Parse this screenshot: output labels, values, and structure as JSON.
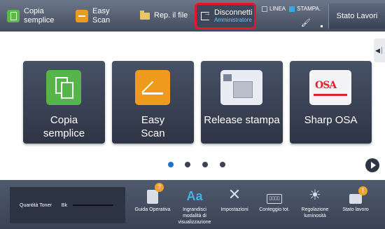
{
  "topbar": {
    "copy_label_l1": "Copia",
    "copy_label_l2": "semplice",
    "scan_label_l1": "Easy",
    "scan_label_l2": "Scan",
    "rep_label": "Rep. il file",
    "logout_label": "Disconnetti",
    "logout_user": "Amministratore",
    "linea_label": "LINEA",
    "stampa_label": "STAMPA.",
    "job_status_label": "Stato Lavori"
  },
  "tiles": [
    {
      "label_l1": "Copia",
      "label_l2": "semplice",
      "icon": "copy-icon"
    },
    {
      "label_l1": "Easy",
      "label_l2": "Scan",
      "icon": "scan-icon"
    },
    {
      "label_l1": "Release stampa",
      "label_l2": "",
      "icon": "printer-icon"
    },
    {
      "label_l1": "Sharp OSA",
      "label_l2": "",
      "icon": "osa-icon",
      "icon_text": "OSA"
    }
  ],
  "pager": {
    "pages": 4,
    "active": 1
  },
  "bottom": {
    "toner_label": "Quantità Toner",
    "toner_color": "Bk",
    "shortcuts": [
      {
        "label": "Guida Operativa",
        "icon": "help-book-icon"
      },
      {
        "label": "Ingrandisci modalità di visualizzazione",
        "icon": "magnify-text-icon"
      },
      {
        "label": "Impostazioni",
        "icon": "settings-tools-icon"
      },
      {
        "label": "Conteggio tot.",
        "icon": "counter-icon"
      },
      {
        "label": "Regolazione luminosità",
        "icon": "brightness-icon"
      },
      {
        "label": "Stato lavoro",
        "icon": "job-status-icon"
      }
    ]
  },
  "colors": {
    "highlight": "#e2172b",
    "copy_accent": "#55b54a",
    "scan_accent": "#ee9a1d",
    "active_page": "#1e6fd0"
  }
}
